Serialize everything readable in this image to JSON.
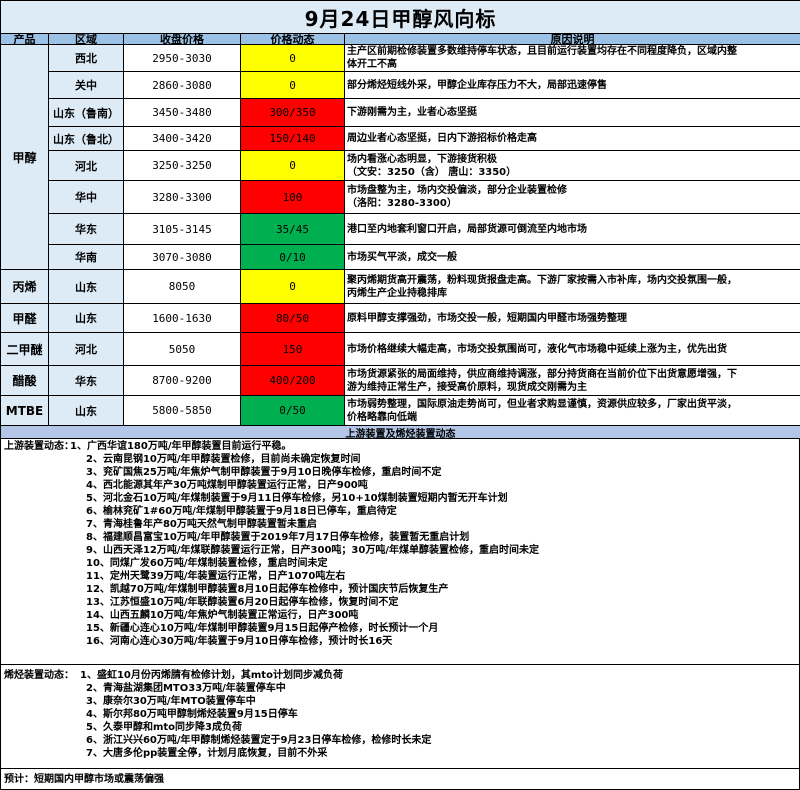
{
  "title": "9月24日甲醇风向标",
  "headers": {
    "product": "产品",
    "region": "区域",
    "price": "收盘价格",
    "change": "价格动态",
    "reason": "原因说明"
  },
  "products": [
    {
      "name": "甲醇"
    },
    {
      "name": "丙烯"
    },
    {
      "name": "甲醛"
    },
    {
      "name": "二甲醚"
    },
    {
      "name": "醋酸"
    },
    {
      "name": "MTBE"
    }
  ],
  "rows": [
    {
      "region": "西北",
      "price": "2950-3030",
      "change": "0",
      "color": "yellow",
      "reason": [
        "主产区前期检修装置多数维持停车状态，且目前运行装置均存在不同程度降负，区域内整",
        "体开工不高"
      ]
    },
    {
      "region": "关中",
      "price": "2860-3080",
      "change": "0",
      "color": "yellow",
      "reason": [
        "部分烯烃短线外采，甲醇企业库存压力不大，局部迅速停售"
      ]
    },
    {
      "region": "山东（鲁南）",
      "price": "3450-3480",
      "change": "300/350",
      "color": "red",
      "reason": [
        "下游刚需为主，业者心态坚挺"
      ]
    },
    {
      "region": "山东（鲁北）",
      "price": "3400-3420",
      "change": "150/140",
      "color": "red",
      "reason": [
        "周边业者心态坚挺，日内下游招标价格走高"
      ]
    },
    {
      "region": "河北",
      "price": "3250-3250",
      "change": "0",
      "color": "yellow",
      "reason": [
        "场内看涨心态明显，下游接货积极",
        "（文安：3250（含） 唐山：3350）"
      ]
    },
    {
      "region": "华中",
      "price": "3280-3300",
      "change": "100",
      "color": "red",
      "reason": [
        "市场盘整为主，场内交投偏淡，部分企业装置检修",
        "（洛阳：3280-3300）"
      ]
    },
    {
      "region": "华东",
      "price": "3105-3145",
      "change": "35/45",
      "color": "green",
      "reason": [
        "港口至内地套利窗口开启，局部货源可倒流至内地市场"
      ]
    },
    {
      "region": "华南",
      "price": "3070-3080",
      "change": "0/10",
      "color": "green",
      "reason": [
        "市场买气平淡，成交一般"
      ]
    },
    {
      "region": "山东",
      "price": "8050",
      "change": "0",
      "color": "yellow",
      "reason": [
        "聚丙烯期货高开震荡，粉料现货报盘走高。下游厂家按需入市补库，场内交投氛围一般，",
        "丙烯生产企业持稳排库"
      ]
    },
    {
      "region": "山东",
      "price": "1600-1630",
      "change": "80/50",
      "color": "red",
      "reason": [
        "原料甲醇支撑强劲，市场交投一般，短期国内甲醛市场强势整理"
      ]
    },
    {
      "region": "河北",
      "price": "5050",
      "change": "150",
      "color": "red",
      "reason": [
        "市场价格继续大幅走高，市场交投氛围尚可，液化气市场稳中延续上涨为主，优先出货"
      ]
    },
    {
      "region": "华东",
      "price": "8700-9200",
      "change": "400/200",
      "color": "red",
      "reason": [
        "市场货源紧张的局面维持，供应商维持调涨，部分持货商在当前价位下出货意愿增强，下",
        "游为维持正常生产，接受高价原料，现货成交刚需为主"
      ]
    },
    {
      "region": "山东",
      "price": "5800-5850",
      "change": "0/50",
      "color": "green",
      "reason": [
        "市场弱势整理，国际原油走势尚可，但业者求购显谨慎，资源供应较多，厂家出货平淡，",
        "价格略靠向低端"
      ]
    }
  ],
  "band_title": "上游装置及烯烃装置动态",
  "upstream": {
    "label": "上游装置动态：",
    "items": [
      "1、广西华谊180万吨/年甲醇装置目前运行平稳。",
      "2、云南昆钢10万吨/年甲醇装置检修，目前尚未确定恢复时间",
      "3、兖矿国焦25万吨/年焦炉气制甲醇装置于9月10日晚停车检修，重启时间不定",
      "4、西北能源其年产30万吨煤制甲醇装置运行正常，日产900吨",
      "5、河北金石10万吨/年煤制装置于9月11日停车检修，另10+10煤制装置短期内暂无开车计划",
      "6、榆林兖矿1#60万吨/年煤制甲醇装置于9月18日已停车，重启待定",
      "7、青海桂鲁年产80万吨天然气制甲醇装置暂未重启",
      "8、福建顺昌富宝10万吨/年甲醇装置于2019年7月17日停车检修，装置暂无重启计划",
      "9、山西天泽12万吨/年煤联醇装置运行正常，日产300吨；30万吨/年煤单醇装置检修，重启时间未定",
      "10、同煤广发60万吨/年煤制装置检修，重启时间未定",
      "11、定州天鹭39万吨/年装置运行正常，日产1070吨左右",
      "12、凯越70万吨/年煤制甲醇装置8月10日起停车检修中，预计国庆节后恢复生产",
      "13、江苏恒盛10万吨/年联醇装置6月20日起停车检修，恢复时间不定",
      "14、山西五麟10万吨/年焦炉气制装置正常运行，日产300吨",
      "15、新疆心连心10万吨/年煤制甲醇装置9月15日起停产检修，时长预计一个月",
      "16、河南心连心30万吨/年装置于9月10日停车检修，预计时长16天"
    ]
  },
  "olefin": {
    "label": "烯烃装置动态：",
    "items": [
      "1、盛虹10月份丙烯腈有检修计划，其mto计划同步减负荷",
      "2、青海盐湖集团MTO33万吨/年装置停车中",
      "3、康奈尔30万吨/年MTO装置停车中",
      "4、斯尔邦80万吨甲醇制烯烃装置9月15日停车",
      "5、久泰甲醇和mto同步降3成负荷",
      "6、浙江兴兴60万吨/年甲醇制烯烃装置定于9月23日停车检修，检修时长未定",
      "7、大唐多伦pp装置全停，计划月底恢复，目前不外采"
    ]
  },
  "forecast": "预计：短期国内甲醇市场或震荡偏强"
}
